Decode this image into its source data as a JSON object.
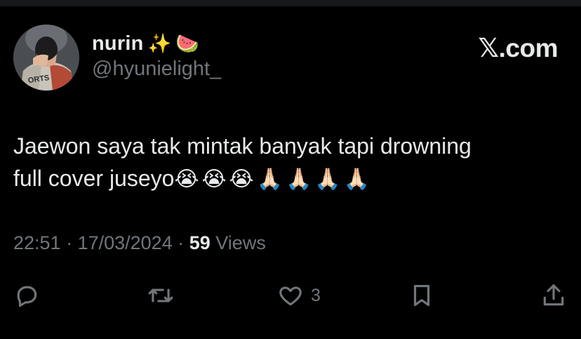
{
  "author": {
    "display_name": "nurin",
    "name_emojis": [
      "✨",
      "🍉"
    ],
    "handle": "@hyunielight_",
    "avatar_jersey_text": "ORTS"
  },
  "brand": "𝕏.com",
  "tweet": {
    "text_line1": "Jaewon saya tak mintak banyak tapi drowning",
    "text_line2": "full cover juseyo",
    "emojis": "😭😭😭🙏🏻🙏🏻🙏🏻🙏🏻"
  },
  "meta": {
    "time": "22:51",
    "separator": " · ",
    "date": "17/03/2024",
    "views_count": "59",
    "views_label": "Views"
  },
  "actions": {
    "reply_icon": "reply-icon",
    "retweet_icon": "retweet-icon",
    "like_icon": "heart-icon",
    "like_count": "3",
    "bookmark_icon": "bookmark-icon",
    "share_icon": "share-icon"
  },
  "colors": {
    "background": "#000000",
    "primary_text": "#e7e9ea",
    "secondary_text": "#71767b"
  }
}
